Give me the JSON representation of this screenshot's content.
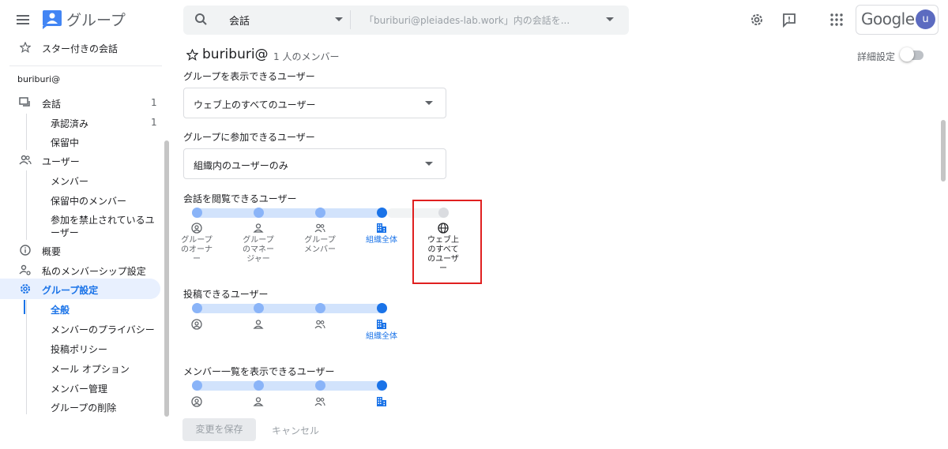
{
  "header": {
    "app_title": "グループ",
    "search": {
      "scope": "会話",
      "placeholder": "「buriburi@pleiades-lab.work」内の会話を..."
    },
    "google_logo": "Google",
    "avatar_initial": "u"
  },
  "sidebar": {
    "starred": "スター付きの会話",
    "group_email": "buriburi@",
    "items": {
      "conversations": {
        "label": "会話",
        "count": "1"
      },
      "approved": {
        "label": "承認済み",
        "count": "1"
      },
      "pending": {
        "label": "保留中"
      },
      "users": {
        "label": "ユーザー"
      },
      "members": {
        "label": "メンバー"
      },
      "pending_members": {
        "label": "保留中のメンバー"
      },
      "banned_line1": "参加を禁止されているユ",
      "banned_line2": "ーザー",
      "about": {
        "label": "概要"
      },
      "my_membership": {
        "label": "私のメンバーシップ設定"
      },
      "group_settings": {
        "label": "グループ設定"
      },
      "general": {
        "label": "全般"
      },
      "member_privacy": {
        "label": "メンバーのプライバシー"
      },
      "posting_policy": {
        "label": "投稿ポリシー"
      },
      "email_options": {
        "label": "メール オプション"
      },
      "member_management": {
        "label": "メンバー管理"
      },
      "delete_group": {
        "label": "グループの削除"
      }
    }
  },
  "main": {
    "group_name": "buriburi@",
    "member_count": "1 人のメンバー",
    "detail_toggle_label": "詳細設定",
    "view_group_label": "グループを表示できるユーザー",
    "view_group_value": "ウェブ上のすべてのユーザー",
    "join_group_label": "グループに参加できるユーザー",
    "join_group_value": "組織内のユーザーのみ",
    "view_conversations": {
      "label": "会話を閲覧できるユーザー",
      "options": [
        {
          "line1": "グループ",
          "line2": "のオーナ",
          "line3": "ー"
        },
        {
          "line1": "グループ",
          "line2": "のマネー",
          "line3": "ジャー"
        },
        {
          "line1": "グループ",
          "line2": "メンバー",
          "line3": ""
        },
        {
          "line1": "組織全体",
          "line2": "",
          "line3": ""
        },
        {
          "line1": "ウェブ上",
          "line2": "のすべて",
          "line3": "のユーザ",
          "line4": "ー"
        }
      ],
      "selected_index": 3
    },
    "post": {
      "label": "投稿できるユーザー",
      "selected_label": "組織全体",
      "selected_index": 3
    },
    "view_members": {
      "label": "メンバー一覧を表示できるユーザー",
      "selected_index": 3
    },
    "save_button": "変更を保存",
    "cancel_button": "キャンセル"
  },
  "colors": {
    "accent": "#1a73e8",
    "track": "#d2e3fc",
    "dot": "#8ab4f8",
    "highlight": "#e02020"
  },
  "icons": [
    "menu-icon",
    "groups-logo-icon",
    "search-icon",
    "settings-icon",
    "feedback-icon",
    "apps-icon",
    "star-icon",
    "conversation-icon",
    "people-icon",
    "info-icon",
    "person-settings-icon",
    "gear-icon",
    "owner-icon",
    "manager-icon",
    "members-icon",
    "building-icon",
    "globe-icon"
  ]
}
